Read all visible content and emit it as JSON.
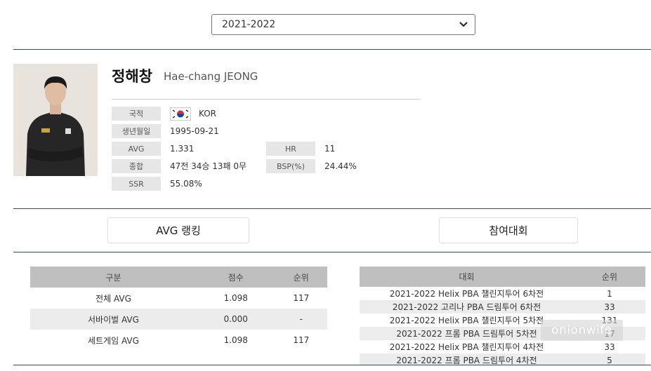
{
  "season": {
    "selected": "2021-2022"
  },
  "player": {
    "name_ko": "정해창",
    "name_en": "Hae-chang JEONG",
    "fields": {
      "nationality": {
        "label": "국적",
        "value": "KOR"
      },
      "birth": {
        "label": "생년월일",
        "value": "1995-09-21"
      },
      "avg": {
        "label": "AVG",
        "value": "1.331"
      },
      "hr": {
        "label": "HR",
        "value": "11"
      },
      "record": {
        "label": "종합",
        "value": "47전 34승 13패 0무"
      },
      "bsp": {
        "label": "BSP(%)",
        "value": "24.44%"
      },
      "ssr": {
        "label": "SSR",
        "value": "55.08%"
      }
    }
  },
  "tabs": {
    "avg_ranking": "AVG 랭킹",
    "participation": "참여대회"
  },
  "avg_table": {
    "headers": [
      "구분",
      "점수",
      "순위"
    ],
    "rows": [
      [
        "전체 AVG",
        "1.098",
        "117"
      ],
      [
        "서바이벌 AVG",
        "0.000",
        "-"
      ],
      [
        "세트게임 AVG",
        "1.098",
        "117"
      ]
    ]
  },
  "part_table": {
    "headers": [
      "대회",
      "순위"
    ],
    "rows": [
      [
        "2021-2022 Helix PBA 챌린지투어 6차전",
        "1"
      ],
      [
        "2021-2022 고리나 PBA 드림투어 6차전",
        "33"
      ],
      [
        "2021-2022 Helix PBA 챌린지투어 5차전",
        "131"
      ],
      [
        "2021-2022 프롬 PBA 드림투어 5차전",
        "17"
      ],
      [
        "2021-2022 Helix PBA 챌린지투어 4차전",
        "33"
      ],
      [
        "2021-2022 프롬 PBA 드림투어 4차전",
        "5"
      ]
    ]
  },
  "watermark": "onionwife",
  "colors": {
    "rule": "#2f4f5f",
    "label_bg": "#e6e6e6",
    "header_bg": "#bfbfbf"
  }
}
